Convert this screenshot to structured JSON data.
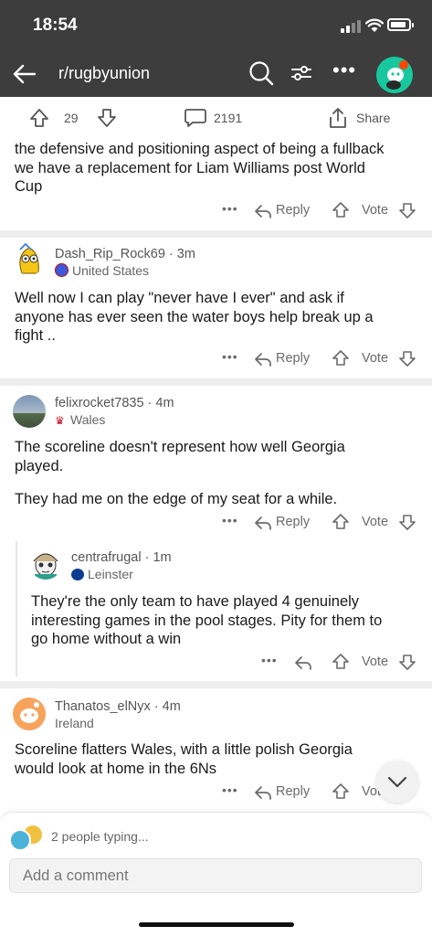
{
  "status_bar": {
    "time": "18:54"
  },
  "nav": {
    "subreddit": "r/rugbyunion",
    "more": "•••"
  },
  "post_bar": {
    "score": "29",
    "comments": "2191",
    "share": "Share"
  },
  "actions": {
    "more": "•••",
    "reply": "Reply",
    "vote": "Vote"
  },
  "comments": [
    {
      "body_lines": [
        "the defensive and positioning aspect of being a fullback",
        "we have a replacement for Liam Williams post World",
        "Cup"
      ]
    },
    {
      "author": "Dash_Rip_Rock69",
      "time": "3m",
      "flair": "United States",
      "body_lines": [
        "Well now I can play \"never have I ever\" and ask if",
        "anyone has ever seen the water boys help break up a",
        "fight .."
      ]
    },
    {
      "author": "felixrocket7835",
      "time": "4m",
      "flair": "Wales",
      "body_lines": [
        "The scoreline doesn't represent how well Georgia",
        "played."
      ],
      "body2": "They had me on the edge of my seat for a while."
    },
    {
      "author": "centrafrugal",
      "time": "1m",
      "flair": "Leinster",
      "body_lines": [
        "They're the only team to have played 4 genuinely",
        "interesting games in the pool stages. Pity for them to",
        "go home without a win"
      ]
    },
    {
      "author": "Thanatos_elNyx",
      "time": "4m",
      "flair": "Ireland",
      "body_lines": [
        "Scoreline flatters Wales, with a little polish Georgia",
        "would look at home in the 6Ns"
      ]
    }
  ],
  "bottom": {
    "typing": "2 people typing...",
    "comment_placeholder": "Add a comment"
  },
  "colors": {
    "header": "#3d3d3d",
    "divider": "#ededed",
    "avatar_teal": "#17c89e",
    "text": "#1a1a1b",
    "muted": "#6a6a6a"
  }
}
